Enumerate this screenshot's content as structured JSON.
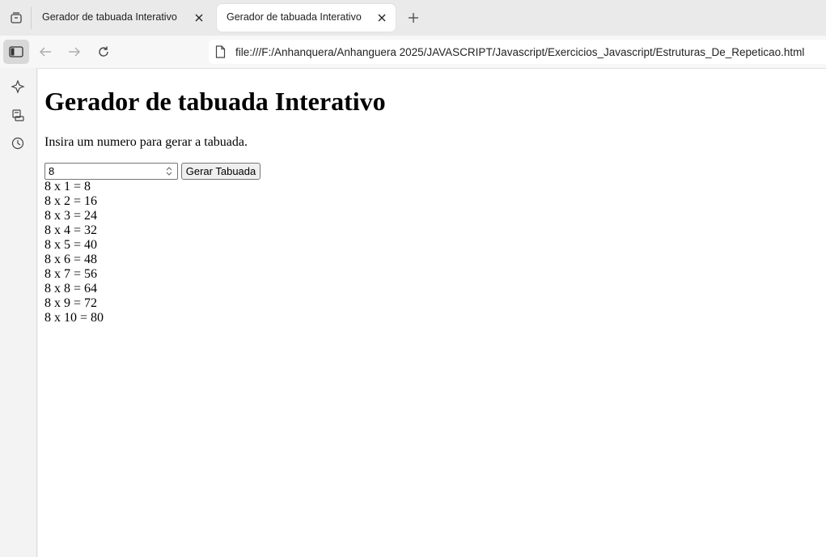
{
  "browser": {
    "tabs": [
      {
        "title": "Gerador de tabuada Interativo",
        "active": false
      },
      {
        "title": "Gerador de tabuada Interativo",
        "active": true
      }
    ],
    "address": "file:///F:/Anhanquera/Anhanguera 2025/JAVASCRIPT/Javascript/Exercicios_Javascript/Estruturas_De_Repeticao.html"
  },
  "page": {
    "heading": "Gerador de tabuada Interativo",
    "intro": "Insira um numero para gerar a tabuada.",
    "input_value": "8",
    "button_label": "Gerar Tabuada",
    "results": [
      "8 x 1 = 8",
      "8 x 2 = 16",
      "8 x 3 = 24",
      "8 x 4 = 32",
      "8 x 5 = 40",
      "8 x 6 = 48",
      "8 x 7 = 56",
      "8 x 8 = 64",
      "8 x 9 = 72",
      "8 x 10 = 80"
    ]
  },
  "icons": {
    "tab_actions": "tab-actions-icon",
    "close": "close-icon",
    "new_tab": "plus-icon",
    "sidebar_toggle": "sidebar-toggle-icon",
    "back": "back-arrow-icon",
    "forward": "forward-arrow-icon",
    "reload": "reload-icon",
    "file": "file-icon",
    "copilot": "copilot-icon",
    "shopping": "shopping-icon",
    "history": "history-icon"
  }
}
